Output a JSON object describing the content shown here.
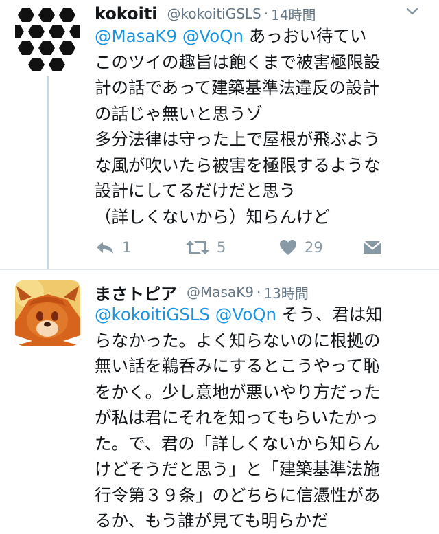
{
  "tweets": [
    {
      "name": "kokoiti",
      "handle": "@kokoitiGSLS",
      "separator": "·",
      "time": "14時間",
      "lines": [
        {
          "mentions": "@MasaK9 @VoQn",
          "text": " あっおい待てい"
        },
        {
          "mentions": "",
          "text": "このツイの趣旨は飽くまで被害極限設"
        },
        {
          "mentions": "",
          "text": "計の話であって建築基準法違反の設計"
        },
        {
          "mentions": "",
          "text": "の話じゃ無いと思うゾ"
        },
        {
          "mentions": "",
          "text": "多分法律は守った上で屋根が飛ぶよう"
        },
        {
          "mentions": "",
          "text": "な風が吹いたら被害を極限するような"
        },
        {
          "mentions": "",
          "text": "設計にしてるだけだと思う"
        },
        {
          "mentions": "",
          "text": "（詳しくないから）知らんけど"
        }
      ],
      "actions": {
        "reply_count": "1",
        "retweet_count": "5",
        "like_count": "29"
      },
      "icons": {
        "avatar": "hexagon-pattern-avatar",
        "reply": "reply-icon",
        "retweet": "retweet-icon",
        "like": "heart-icon",
        "dm": "envelope-icon",
        "menu": "chevron-down-icon"
      }
    },
    {
      "name": "まさトピア",
      "handle": "@MasaK9",
      "separator": "·",
      "time": "13時間",
      "lines": [
        {
          "mentions": "@kokoitiGSLS @VoQn",
          "text": " そう、君は知"
        },
        {
          "mentions": "",
          "text": "らなかった。よく知らないのに根拠の"
        },
        {
          "mentions": "",
          "text": "無い話を鵜呑みにするとこうやって恥"
        },
        {
          "mentions": "",
          "text": "をかく。少し意地が悪いやり方だった"
        },
        {
          "mentions": "",
          "text": "が私は君にそれを知ってもらいたかっ"
        },
        {
          "mentions": "",
          "text": "た。で、君の「詳しくないから知らん"
        },
        {
          "mentions": "",
          "text": "けどそうだと思う」と「建築基準法施"
        },
        {
          "mentions": "",
          "text": "行令第３９条」のどちらに信憑性があ"
        },
        {
          "mentions": "",
          "text": "るか、もう誰が見ても明らかだ"
        }
      ],
      "icons": {
        "avatar": "furry-character-avatar",
        "menu": "chevron-down-icon"
      }
    }
  ],
  "colors": {
    "mention": "#1b95e0",
    "meta": "#657786",
    "action": "#8899a6",
    "thread_line": "#ccd6dd"
  }
}
